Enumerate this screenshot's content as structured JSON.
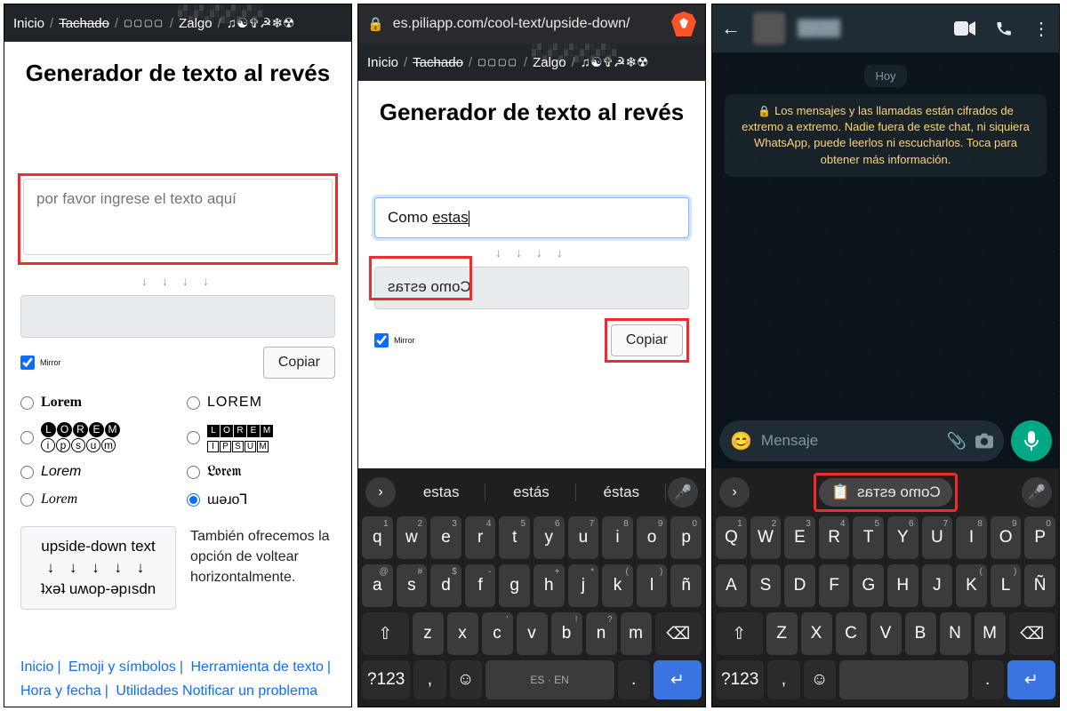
{
  "panel1": {
    "crumbs": {
      "home": "Inicio",
      "strike": "Tachado",
      "zalgo": "Zalgo",
      "symbols": "♫☯✞☭❄☢"
    },
    "title": "Generador de texto al revés",
    "input_placeholder": "por favor ingrese el texto aquí",
    "arrows": "↓ ↓ ↓ ↓",
    "mirror_label": "Mirror",
    "copy": "Copiar",
    "radios": {
      "r1": "Lorem",
      "r2": "LOREM",
      "r3a": "LOREM",
      "r3b": "ipsum",
      "r4a": "LOREM",
      "r4b": "IPSUM",
      "r5": "Lorem",
      "r6": "Lorem",
      "r7": "Lorem",
      "r8": "ɯǝɹo⅂"
    },
    "demo": {
      "l1": "upside-down text",
      "l2": "↓ ↓ ↓ ↓ ↓",
      "l3": "ʇxǝʇ uʍop-ǝpısdn"
    },
    "demo_desc": "También ofrecemos la opción de voltear horizontalmente.",
    "footer": {
      "a": "Inicio",
      "b": "Emoji y símbolos",
      "c": "Herramienta de texto",
      "d": "Hora y fecha",
      "e": "Utilidades Notificar un problema"
    }
  },
  "panel2": {
    "url": "es.piliapp.com/cool-text/upside-down/",
    "crumbs": {
      "home": "Inicio",
      "strike": "Tachado",
      "zalgo": "Zalgo",
      "symbols": "♫☯✞☭❄☢"
    },
    "title": "Generador de texto al revés",
    "input_value": "Como estas",
    "arrows": "↓ ↓ ↓ ↓",
    "output": "Como esтas",
    "copy": "Copiar",
    "mirror_label": "Mirror",
    "suggestions": [
      "estas",
      "estás",
      "éstas"
    ],
    "rows": {
      "r1": [
        "q",
        "w",
        "e",
        "r",
        "t",
        "y",
        "u",
        "i",
        "o",
        "p"
      ],
      "r1s": [
        "1",
        "2",
        "3",
        "4",
        "5",
        "6",
        "7",
        "8",
        "9",
        "0"
      ],
      "r2": [
        "a",
        "s",
        "d",
        "f",
        "g",
        "h",
        "j",
        "k",
        "l",
        "ñ"
      ],
      "r2s": [
        "@",
        "#",
        "$",
        "-",
        "",
        "+",
        "*",
        "(",
        ")",
        ""
      ],
      "r3": [
        "z",
        "x",
        "c",
        "v",
        "b",
        "n",
        "m"
      ],
      "r3s": [
        "",
        "",
        "'",
        "",
        "!",
        "?",
        ""
      ],
      "sym": "?123",
      "comma": ",",
      "dot": ".",
      "lang": "ES · EN"
    }
  },
  "panel3": {
    "hoy": "Hoy",
    "notice": "Los mensajes y las llamadas están cifrados de extremo a extremo. Nadie fuera de este chat, ni siquiera WhatsApp, puede leerlos ni escucharlos. Toca para obtener más información.",
    "msg_placeholder": "Mensaje",
    "clip_suggest": "Como esтas",
    "rows": {
      "r1": [
        "Q",
        "W",
        "E",
        "R",
        "T",
        "Y",
        "U",
        "I",
        "O",
        "P"
      ],
      "r1s": [
        "1",
        "2",
        "3",
        "4",
        "5",
        "6",
        "7",
        "8",
        "9",
        "0"
      ],
      "r2": [
        "A",
        "S",
        "D",
        "F",
        "G",
        "H",
        "J",
        "K",
        "L",
        "Ñ"
      ],
      "r2s": [
        "",
        "",
        "",
        "",
        "",
        "",
        "",
        "(",
        ")",
        ""
      ],
      "r3": [
        "Z",
        "X",
        "C",
        "V",
        "B",
        "N",
        "M"
      ],
      "sym": "?123",
      "comma": ",",
      "dot": "."
    }
  }
}
